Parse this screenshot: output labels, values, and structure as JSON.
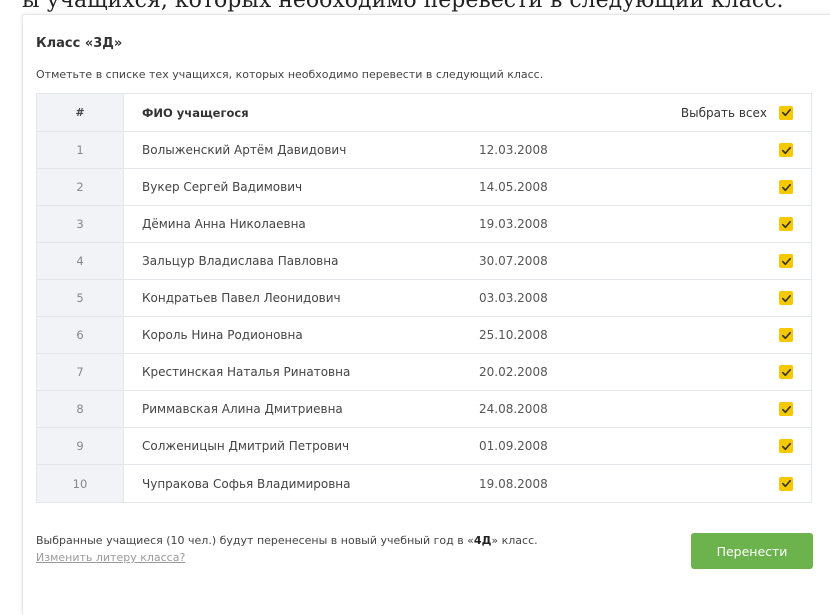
{
  "header_fragment": "ы учащихся, которых необходимо перевести в следующий класс.",
  "title": "Класс «3Д»",
  "instruction": "Отметьте в списке тех учащихся, которых необходимо перевести в следующий класс.",
  "table": {
    "col_num": "#",
    "col_name": "ФИО учащегося",
    "select_all_label": "Выбрать всех",
    "select_all_checked": true,
    "rows": [
      {
        "num": "1",
        "name": "Волыженский Артём Давидович",
        "date": "12.03.2008",
        "checked": true
      },
      {
        "num": "2",
        "name": "Вукер Сергей Вадимович",
        "date": "14.05.2008",
        "checked": true
      },
      {
        "num": "3",
        "name": "Дёмина Анна Николаевна",
        "date": "19.03.2008",
        "checked": true
      },
      {
        "num": "4",
        "name": "Зальцур Владислава Павловна",
        "date": "30.07.2008",
        "checked": true
      },
      {
        "num": "5",
        "name": "Кондратьев Павел Леонидович",
        "date": "03.03.2008",
        "checked": true
      },
      {
        "num": "6",
        "name": "Король Нина Родионовна",
        "date": "25.10.2008",
        "checked": true
      },
      {
        "num": "7",
        "name": "Крестинская Наталья Ринатовна",
        "date": "20.02.2008",
        "checked": true
      },
      {
        "num": "8",
        "name": "Риммавская Алина Дмитриевна",
        "date": "24.08.2008",
        "checked": true
      },
      {
        "num": "9",
        "name": "Солженицын Дмитрий Петрович",
        "date": "01.09.2008",
        "checked": true
      },
      {
        "num": "10",
        "name": "Чупракова Софья Владимировна",
        "date": "19.08.2008",
        "checked": true
      }
    ]
  },
  "footer": {
    "text_before": "Выбранные учащиеся (10 чел.) будут перенесены в новый учебный год в «",
    "target_class": "4Д",
    "text_after": "» класс.",
    "change_link": "Изменить литеру класса?",
    "transfer_button": "Перенести"
  },
  "colors": {
    "checkbox": "#f5c800",
    "button": "#6cb34d"
  }
}
